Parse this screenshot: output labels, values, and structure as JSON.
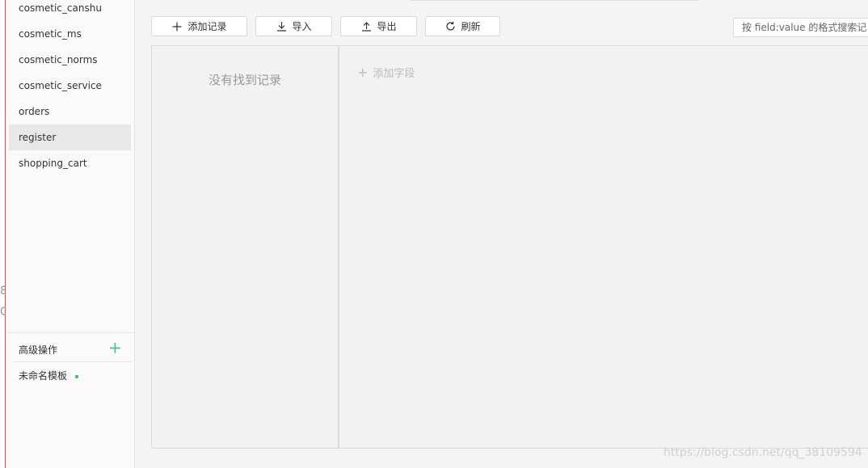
{
  "sidebar": {
    "collections": [
      {
        "label": "cosmetic_canshu"
      },
      {
        "label": "cosmetic_ms"
      },
      {
        "label": "cosmetic_norms"
      },
      {
        "label": "cosmetic_service"
      },
      {
        "label": "orders"
      },
      {
        "label": "register",
        "active": true
      },
      {
        "label": "shopping_cart"
      }
    ],
    "advanced_label": "高级操作",
    "advanced_add_icon": "plus-icon",
    "template_label": "未命名模板",
    "template_dot_color": "#3cc371"
  },
  "toolbar": {
    "add_record": "添加记录",
    "import": "导入",
    "export": "导出",
    "refresh": "刷新",
    "search_placeholder": "按 field:value 的格式搜索记"
  },
  "main": {
    "empty_text": "没有找到记录",
    "add_field": "添加字段"
  },
  "edge": {
    "glyph1": "8",
    "glyph2": "G"
  },
  "watermark": "https://blog.csdn.net/qq_38109594",
  "colors": {
    "accent": "#4fc08d",
    "active_row": "#e8e8e8"
  }
}
